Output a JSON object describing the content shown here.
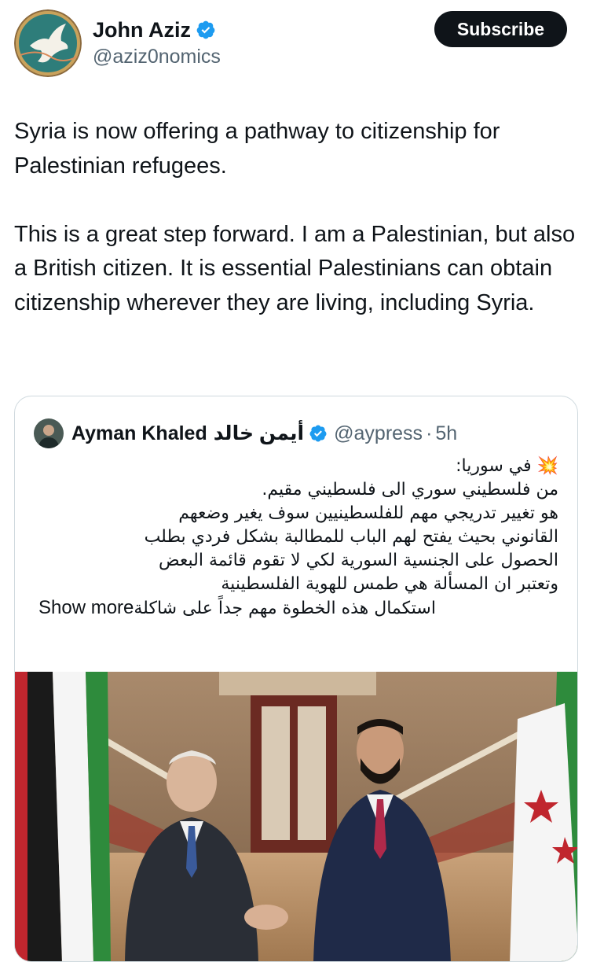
{
  "author": {
    "name": "John Aziz",
    "handle": "@aziz0nomics",
    "subscribe_label": "Subscribe"
  },
  "tweet": {
    "text": "Syria is now offering a pathway to citizenship for Palestinian refugees.\n\nThis is a great step forward. I am a Palestinian, but also a British citizen. It is essential Palestinians can obtain citizenship wherever they are living, including Syria."
  },
  "quote": {
    "name": "Ayman Khaled",
    "name_arabic": "أيمن خالد",
    "handle": "@aypress",
    "separator": "·",
    "time": "5h",
    "lines": [
      "💥 في سوريا:",
      "من فلسطيني سوري الى فلسطيني مقيم.",
      "هو تغيير تدريجي مهم للفلسطينيين سوف يغير وضعهم",
      "القانوني بحيث يفتح لهم الباب للمطالبة بشكل فردي بطلب",
      "الحصول على الجنسية السورية لكي لا تقوم قائمة البعض",
      "وتعتبر ان المسألة هي طمس للهوية الفلسطينية"
    ],
    "last_line": "استكمال هذه الخطوة مهم جداً على شاكلة",
    "show_more": "Show more"
  },
  "icons": {
    "verified": "verified-badge-icon",
    "avatar": "dove-logo-avatar"
  },
  "colors": {
    "verified_blue": "#1d9bf0",
    "muted_text": "#536471",
    "button_bg": "#0f1419",
    "border": "#cfd9de"
  }
}
